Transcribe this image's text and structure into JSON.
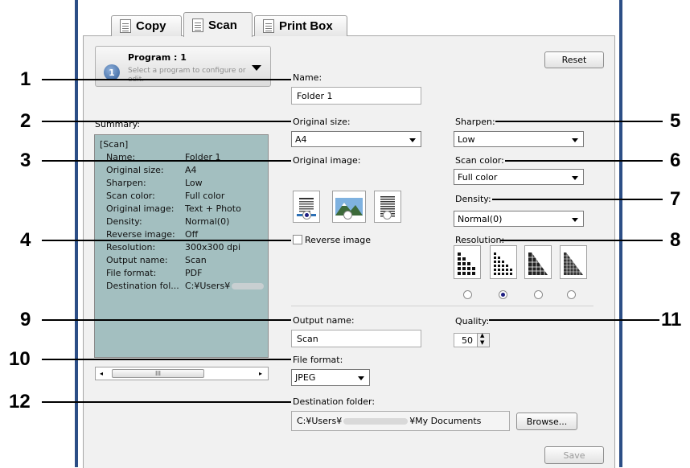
{
  "tabs": [
    {
      "label": "Copy",
      "icon": "copy-icon",
      "active": false
    },
    {
      "label": "Scan",
      "icon": "scan-icon",
      "active": true
    },
    {
      "label": "Print Box",
      "icon": "print-box-icon",
      "active": false
    }
  ],
  "program": {
    "number": "1",
    "title": "Program : 1",
    "hint": "Select a program to configure or edit."
  },
  "reset_label": "Reset",
  "name": {
    "label": "Name:",
    "value": "Folder 1"
  },
  "summary": {
    "label": "Summary:",
    "heading": "[Scan]",
    "rows": [
      {
        "key": "Name:",
        "value": "Folder 1"
      },
      {
        "key": "Original size:",
        "value": "A4"
      },
      {
        "key": "Sharpen:",
        "value": "Low"
      },
      {
        "key": "Scan color:",
        "value": "Full color"
      },
      {
        "key": "Original image:",
        "value": "Text + Photo"
      },
      {
        "key": "Density:",
        "value": "Normal(0)"
      },
      {
        "key": "Reverse image:",
        "value": "Off"
      },
      {
        "key": "Resolution:",
        "value": "300x300 dpi"
      },
      {
        "key": "Output name:",
        "value": "Scan"
      },
      {
        "key": "File format:",
        "value": "PDF"
      },
      {
        "key": "Destination fol...",
        "value": "C:¥Users¥"
      }
    ],
    "scroll_thumb": "III"
  },
  "original_size": {
    "label": "Original size:",
    "value": "A4"
  },
  "original_image": {
    "label": "Original image:",
    "options": [
      "Text",
      "Photo",
      "Text + Photo"
    ],
    "selected_index": 0
  },
  "reverse_image": {
    "label": "Reverse image",
    "checked": false
  },
  "sharpen": {
    "label": "Sharpen:",
    "value": "Low"
  },
  "scan_color": {
    "label": "Scan color:",
    "value": "Full color"
  },
  "density": {
    "label": "Density:",
    "value": "Normal(0)"
  },
  "resolution": {
    "label": "Resolution:",
    "selected_index": 1
  },
  "output_name": {
    "label": "Output name:",
    "value": "Scan"
  },
  "quality": {
    "label": "Quality:",
    "value": "50"
  },
  "file_format": {
    "label": "File format:",
    "value": "JPEG"
  },
  "destination": {
    "label": "Destination folder:",
    "prefix": "C:¥Users¥",
    "suffix": "¥My Documents"
  },
  "browse_label": "Browse...",
  "save_label": "Save",
  "callouts": [
    "1",
    "2",
    "3",
    "4",
    "5",
    "6",
    "7",
    "8",
    "9",
    "10",
    "11",
    "12"
  ],
  "colors": {
    "frame": "#2c4e86",
    "summary_bg": "#a3bfc0",
    "panel_bg": "#f1f1f1"
  }
}
